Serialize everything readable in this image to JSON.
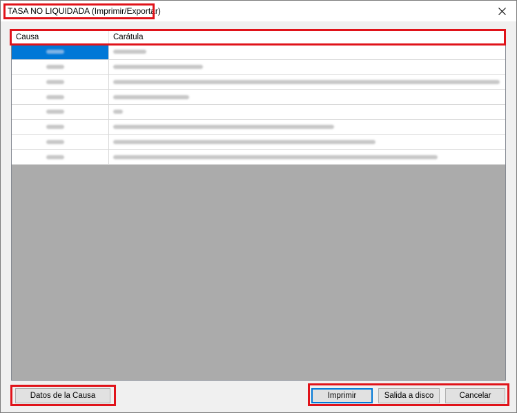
{
  "window": {
    "title": "TASA NO LIQUIDADA (Imprimir/Exportar)",
    "close_icon": "×"
  },
  "grid": {
    "columns": [
      "Causa",
      "Carátula"
    ],
    "rows": [
      {
        "causa": "",
        "caratula": "",
        "selected": true,
        "causa_blur": 26,
        "caratula_blur": 48
      },
      {
        "causa": "",
        "caratula": "",
        "selected": false,
        "causa_blur": 26,
        "caratula_blur": 130
      },
      {
        "causa": "",
        "caratula": "",
        "selected": false,
        "causa_blur": 26,
        "caratula_blur": 560
      },
      {
        "causa": "",
        "caratula": "",
        "selected": false,
        "causa_blur": 26,
        "caratula_blur": 110
      },
      {
        "causa": "",
        "caratula": "",
        "selected": false,
        "causa_blur": 26,
        "caratula_blur": 14
      },
      {
        "causa": "",
        "caratula": "",
        "selected": false,
        "causa_blur": 26,
        "caratula_blur": 320
      },
      {
        "causa": "",
        "caratula": "",
        "selected": false,
        "causa_blur": 26,
        "caratula_blur": 380
      },
      {
        "causa": "",
        "caratula": "",
        "selected": false,
        "causa_blur": 26,
        "caratula_blur": 470
      }
    ]
  },
  "buttons": {
    "datos_causa": "Datos de la Causa",
    "imprimir": "Imprimir",
    "salida_disco": "Salida a disco",
    "cancelar": "Cancelar"
  },
  "colors": {
    "highlight": "#e0131a",
    "selection": "#0078d7",
    "grid_background": "#ababab"
  }
}
